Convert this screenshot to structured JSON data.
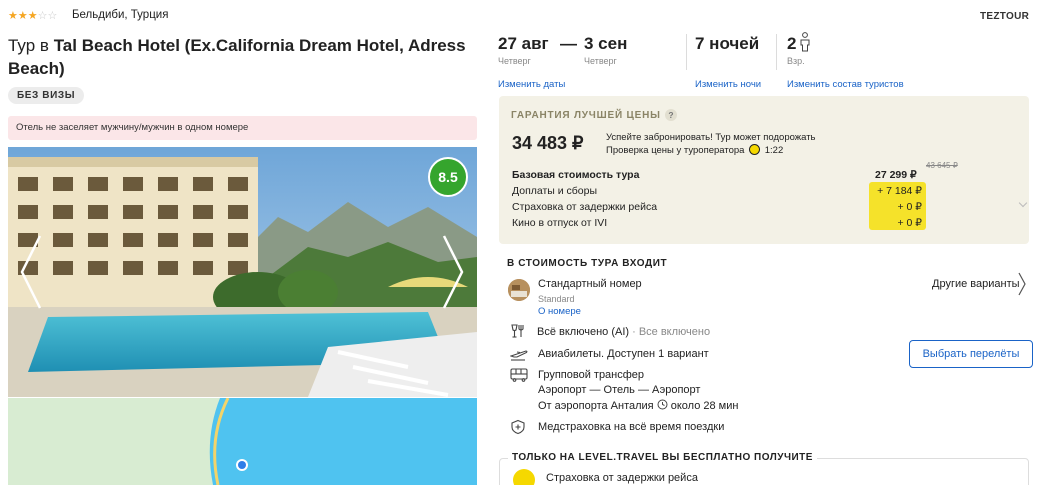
{
  "hotel": {
    "stars": 3,
    "stars_max": 5,
    "location": "Бельдиби, Турция",
    "title_prefix": "Тур в",
    "name": "Tal Beach Hotel (Ex.California Dream Hotel, Adress Beach)",
    "visa_badge": "БЕЗ ВИЗЫ",
    "warning": "Отель не заселяет мужчину/мужчин в одном номере",
    "rating": "8.5"
  },
  "operator": "TEZTOUR",
  "trip": {
    "date_from": "27 авг",
    "dash": "—",
    "date_to": "3 сен",
    "weekday_from": "Четверг",
    "weekday_to": "Четверг",
    "nights": "7 ночей",
    "adults": "2",
    "adults_label": "Взр.",
    "change_dates": "Изменить даты",
    "change_nights": "Изменить ночи",
    "change_tourists": "Изменить состав туристов"
  },
  "price": {
    "guarantee": "ГАРАНТИЯ ЛУЧШЕЙ ЦЕНЫ",
    "help": "?",
    "total": "34 483 ₽",
    "notice_line1": "Успейте забронировать! Тур может подорожать",
    "notice_line2": "Проверка цены у туроператора",
    "timer": "1:22",
    "base_label": "Базовая стоимость тура",
    "base_old": "43 645 ₽",
    "base_value": "27 299 ₽",
    "fees_label": "Доплаты и сборы",
    "fees_value": "+ 7 184 ₽",
    "delay_label": "Страховка от задержки рейса",
    "delay_value": "+ 0 ₽",
    "cinema_label": "Кино в отпуск от IVI",
    "cinema_value": "+ 0 ₽"
  },
  "includes": {
    "title": "В СТОИМОСТЬ ТУРА ВХОДИТ",
    "room_name": "Стандартный номер",
    "room_type": "Standard",
    "room_link": "О номере",
    "other_variants": "Другие варианты",
    "meal_main": "Всё включено (AI)",
    "meal_extra": " · Все включено",
    "flights": "Авиабилеты. Доступен 1 вариант",
    "choose_flights": "Выбрать перелёты",
    "transfer1": "Групповой трансфер",
    "transfer2": "Аэропорт — Отель — Аэропорт",
    "transfer3_prefix": "От аэропорта Анталия",
    "transfer3_suffix": "около 28 мин",
    "insurance": "Медстраховка на всё время поездки"
  },
  "free": {
    "title": "ТОЛЬКО НА LEVEL.TRAVEL ВЫ БЕСПЛАТНО ПОЛУЧИТЕ",
    "item": "Страховка от задержки рейса"
  },
  "colors": {
    "link": "#1a63c7",
    "rating_bg": "#35a52d",
    "highlight": "#f5e22a",
    "price_box_bg": "#f3f1e6",
    "warning_bg": "#fbe6e8"
  }
}
